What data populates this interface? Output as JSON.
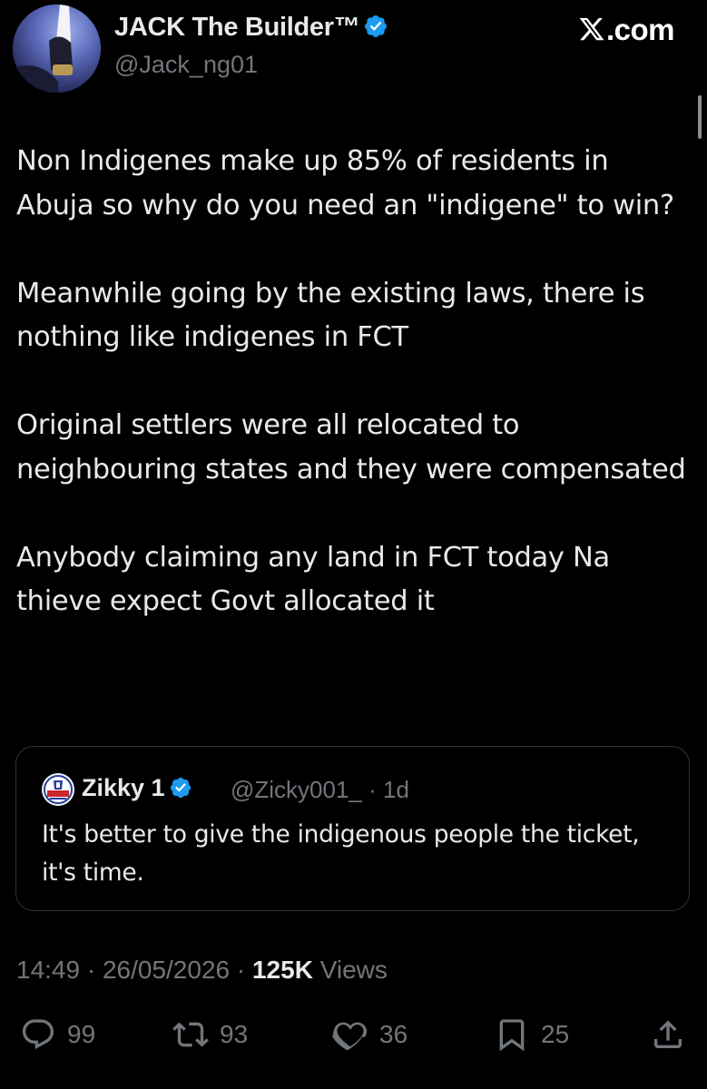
{
  "author": {
    "name": "JACK The Builder™",
    "handle": "@Jack_ng01",
    "verified_color": "#1d9bf0"
  },
  "brand": {
    "logo_text": ".com",
    "logo_icon": "x-logo-icon"
  },
  "tweet": {
    "paragraphs": [
      "Non Indigenes make up 85% of residents in Abuja so why do you need an \"indigene\" to win?",
      "Meanwhile going by the existing laws, there is nothing like indigenes in FCT",
      "Original settlers were all relocated to neighbouring states and they were compensated",
      "Anybody claiming any land in FCT today Na thieve expect Govt allocated it"
    ]
  },
  "quote": {
    "name": "Zikky 1",
    "handle_time": "@Zicky001_ · 1d",
    "text": "It's better to give the indigenous people the ticket, it's time."
  },
  "meta": {
    "timestamp": "14:49 · 26/05/2026 · ",
    "views_count": "125K",
    "views_label": " Views"
  },
  "actions": {
    "replies": "99",
    "reposts": "93",
    "likes": "36",
    "bookmarks": "25"
  },
  "colors": {
    "background": "#000000",
    "text": "#e7e9ea",
    "secondary": "#71767b",
    "border": "#2f3336",
    "verified": "#1d9bf0"
  }
}
